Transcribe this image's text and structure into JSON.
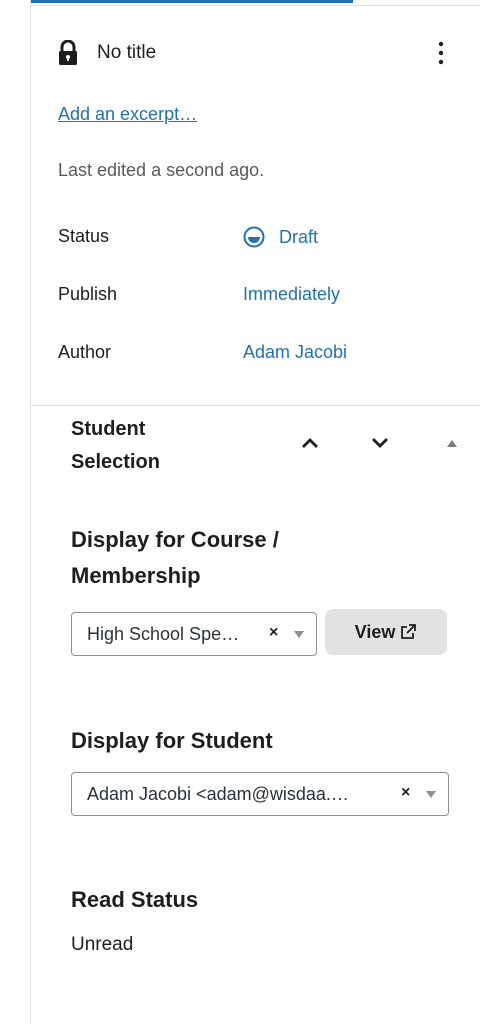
{
  "post": {
    "title": "No title",
    "excerpt_link": "Add an excerpt…",
    "last_edited": "Last edited a second ago.",
    "icons": {
      "lock": "lock-icon",
      "more": "more-vertical-icon"
    }
  },
  "meta": [
    {
      "label": "Status",
      "value": "Draft",
      "icon": "draft-status-icon"
    },
    {
      "label": "Publish",
      "value": "Immediately"
    },
    {
      "label": "Author",
      "value": "Adam Jacobi"
    }
  ],
  "metabox": {
    "title": "Student Selection",
    "controls": [
      "move-up",
      "move-down",
      "toggle-panel"
    ]
  },
  "fields": {
    "course": {
      "heading": "Display for Course / Membership",
      "selected": "High School Spe…",
      "clear": "×",
      "view_label": "View"
    },
    "student": {
      "heading": "Display for Student",
      "selected": "Adam Jacobi <adam@wisdaa.…",
      "clear": "×"
    },
    "read_status": {
      "heading": "Read Status",
      "value": "Unread"
    }
  },
  "colors": {
    "accent": "#2271b1",
    "border": "#e0e0e0",
    "button_bg": "#e2e2e2"
  }
}
